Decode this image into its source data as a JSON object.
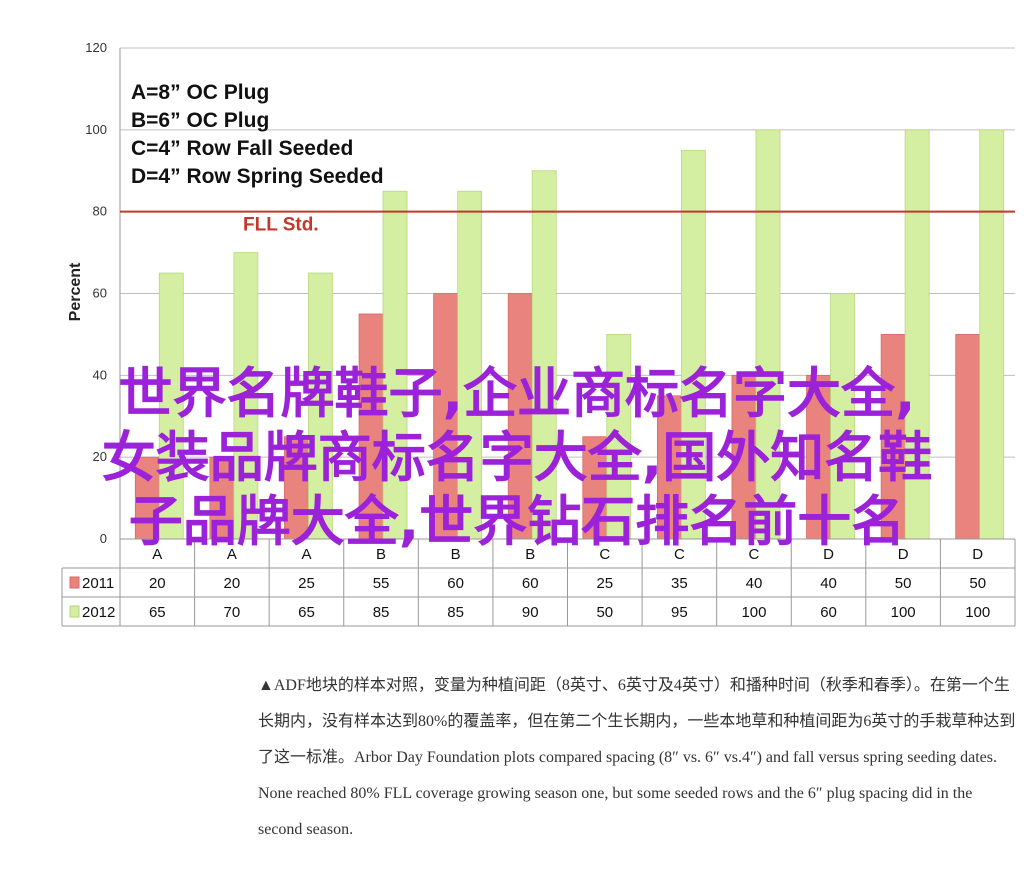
{
  "chart_data": {
    "type": "bar",
    "categories": [
      "A",
      "A",
      "A",
      "B",
      "B",
      "B",
      "C",
      "C",
      "C",
      "D",
      "D",
      "D"
    ],
    "series": [
      {
        "name": "2011",
        "values": [
          20,
          20,
          25,
          55,
          60,
          60,
          25,
          35,
          40,
          40,
          50,
          50
        ],
        "color": "#e8837e"
      },
      {
        "name": "2012",
        "values": [
          65,
          70,
          65,
          85,
          85,
          90,
          50,
          95,
          100,
          60,
          100,
          100
        ],
        "color": "#d4eea2"
      }
    ],
    "ylabel": "Percent",
    "ylim": [
      0,
      120
    ],
    "yticks": [
      0,
      20,
      40,
      60,
      80,
      100,
      120
    ],
    "grid": true,
    "reference_line": {
      "value": 80,
      "label": "FLL Std.",
      "color": "#c0392b"
    },
    "legend_keys": [
      "A=8” OC Plug",
      "B=6” OC Plug",
      "C=4” Row Fall Seeded",
      "D=4” Row Spring Seeded"
    ],
    "data_table": true,
    "legend_placement": "table-left"
  },
  "overlay_text": [
    "世界名牌鞋子,企业商标名字大全,",
    "女装品牌商标名字大全,国外知名鞋",
    "子品牌大全,世界钻石排名前十名"
  ],
  "caption": "▲ADF地块的样本对照，变量为种植间距（8英寸、6英寸及4英寸）和播种时间（秋季和春季）。在第一个生长期内，没有样本达到80%的覆盖率，但在第二个生长期内，一些本地草和种植间距为6英寸的手栽草种达到了这一标准。Arbor Day Foundation plots compared spacing (8″ vs. 6″ vs.4″) and fall versus spring seeding dates. None reached 80% FLL coverage growing season one, but some seeded rows and the 6″ plug spacing did in the second season."
}
